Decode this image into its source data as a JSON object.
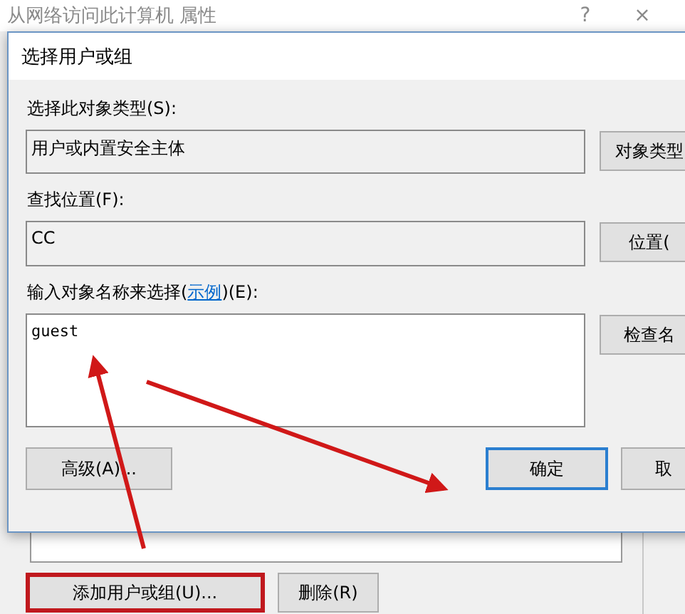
{
  "window": {
    "title": "从网络访问此计算机 属性",
    "help": "?",
    "close": "×",
    "buttons": [
      {
        "label": "添加用户或组(U)...",
        "highlighted": true
      },
      {
        "label": "删除(R)",
        "highlighted": false
      }
    ]
  },
  "dialog": {
    "title": "选择用户或组",
    "object_type": {
      "label": "选择此对象类型(S):",
      "value": "用户或内置安全主体",
      "button": "对象类型"
    },
    "location": {
      "label": "查找位置(F):",
      "value": "CC",
      "button": "位置("
    },
    "names": {
      "label_before": "输入对象名称来选择(",
      "link": "示例",
      "label_after": ")(E):",
      "value": "guest",
      "button": "检查名"
    },
    "advanced_button": "高级(A)...",
    "ok_button": "确定",
    "cancel_button": "取"
  }
}
